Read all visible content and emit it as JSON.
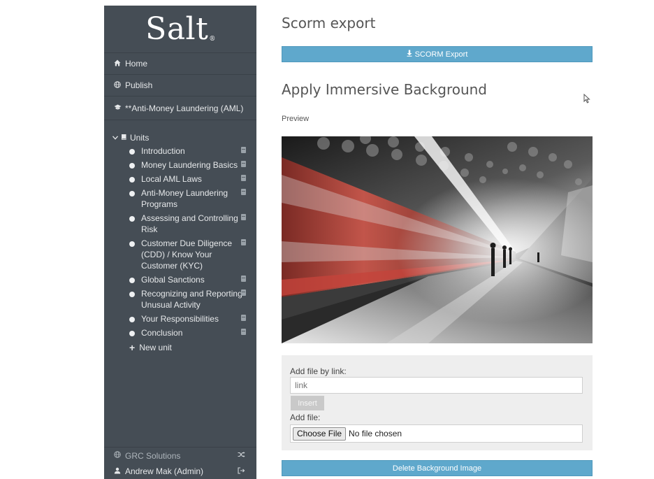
{
  "sidebar": {
    "logo": "Salt",
    "logo_mark": "®",
    "nav": [
      {
        "label": "Home",
        "icon": "home-icon"
      },
      {
        "label": "Publish",
        "icon": "globe-icon"
      },
      {
        "label": "**Anti-Money Laundering (AML)",
        "icon": "graduation-cap-icon"
      }
    ],
    "units_label": "Units",
    "units": [
      {
        "label": "Introduction"
      },
      {
        "label": "Money Laundering Basics"
      },
      {
        "label": "Local AML Laws"
      },
      {
        "label": "Anti-Money Laundering Programs"
      },
      {
        "label": "Assessing and Controlling Risk"
      },
      {
        "label": "Customer Due Diligence (CDD) / Know Your Customer (KYC)"
      },
      {
        "label": "Global Sanctions"
      },
      {
        "label": "Recognizing and Reporting Unusual Activity"
      },
      {
        "label": "Your Responsibilities"
      },
      {
        "label": "Conclusion"
      }
    ],
    "new_unit_label": "New unit",
    "footer": {
      "org": "GRC Solutions",
      "user": "Andrew Mak (Admin)"
    }
  },
  "main": {
    "scorm_title": "Scorm export",
    "scorm_button": "SCORM Export",
    "background_title": "Apply Immersive Background",
    "preview_label": "Preview",
    "upload": {
      "link_label": "Add file by link:",
      "link_placeholder": "link",
      "insert_label": "Insert",
      "file_label": "Add file:",
      "choose_file_label": "Choose File",
      "file_status": "No file chosen"
    },
    "delete_button": "Delete Background Image"
  },
  "colors": {
    "sidebar_bg": "#454d55",
    "accent_blue": "#5fa8cc",
    "panel_bg": "#eeeeee"
  }
}
